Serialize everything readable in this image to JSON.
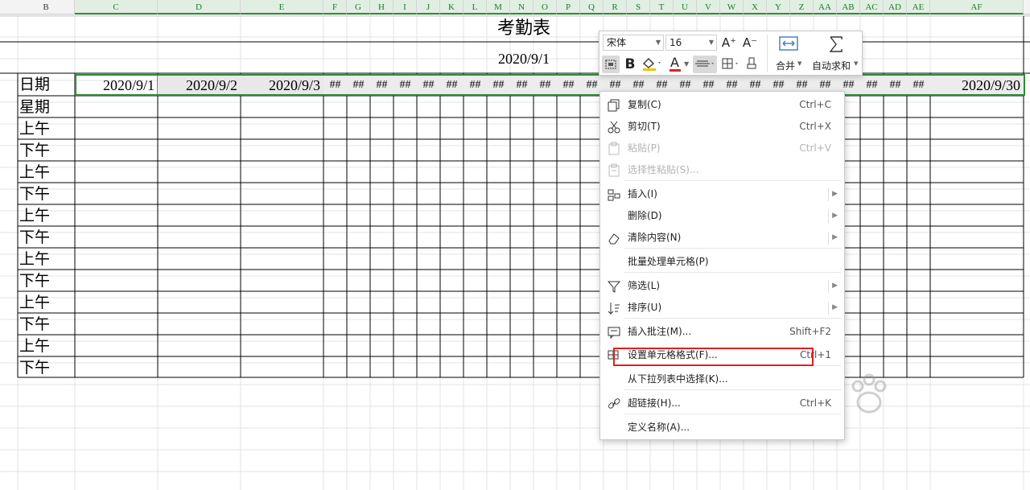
{
  "columns": [
    "B",
    "C",
    "D",
    "E",
    "F",
    "G",
    "H",
    "I",
    "J",
    "K",
    "L",
    "M",
    "N",
    "O",
    "P",
    "Q",
    "R",
    "S",
    "T",
    "U",
    "V",
    "W",
    "X",
    "Y",
    "Z",
    "AA",
    "AB",
    "AC",
    "AD",
    "AE",
    "AF"
  ],
  "title": "考勤表",
  "subtitle_date": "2020/9/1",
  "row_labels": [
    "日期",
    "星期",
    "上午",
    "下午",
    "上午",
    "下午",
    "上午",
    "下午",
    "上午",
    "下午",
    "上午",
    "下午",
    "上午",
    "下午"
  ],
  "dates": [
    "2020/9/1",
    "2020/9/2",
    "2020/9/3"
  ],
  "last_date": "2020/9/30",
  "overflow_marker": "##",
  "mini_toolbar": {
    "font_name": "宋体",
    "font_size": "16",
    "bold_label": "B",
    "font_color_label": "A",
    "grow_font": "A⁺",
    "shrink_font": "A⁻",
    "merge_label": "合并",
    "autosum_label": "自动求和"
  },
  "context_menu": [
    {
      "label": "复制(C)",
      "shortcut": "Ctrl+C",
      "icon": "copy-icon",
      "enabled": true
    },
    {
      "label": "剪切(T)",
      "shortcut": "Ctrl+X",
      "icon": "scissors-icon",
      "enabled": true
    },
    {
      "label": "粘贴(P)",
      "shortcut": "Ctrl+V",
      "icon": "paste-icon",
      "enabled": false
    },
    {
      "label": "选择性粘贴(S)...",
      "shortcut": "",
      "icon": "paste-special-icon",
      "enabled": false
    },
    {
      "label": "插入(I)",
      "shortcut": "",
      "icon": "insert-icon",
      "enabled": true,
      "submenu": true
    },
    {
      "label": "删除(D)",
      "shortcut": "",
      "icon": "",
      "enabled": true,
      "submenu": true
    },
    {
      "label": "清除内容(N)",
      "shortcut": "",
      "icon": "eraser-icon",
      "enabled": true,
      "submenu": true
    },
    {
      "label": "批量处理单元格(P)",
      "shortcut": "",
      "icon": "",
      "enabled": true
    },
    {
      "label": "筛选(L)",
      "shortcut": "",
      "icon": "filter-icon",
      "enabled": true,
      "submenu": true
    },
    {
      "label": "排序(U)",
      "shortcut": "",
      "icon": "sort-icon",
      "enabled": true,
      "submenu": true
    },
    {
      "label": "插入批注(M)...",
      "shortcut": "Shift+F2",
      "icon": "comment-icon",
      "enabled": true
    },
    {
      "label": "设置单元格格式(F)...",
      "shortcut": "Ctrl+1",
      "icon": "format-cells-icon",
      "enabled": true,
      "highlighted": true
    },
    {
      "label": "从下拉列表中选择(K)...",
      "shortcut": "",
      "icon": "",
      "enabled": true
    },
    {
      "label": "超链接(H)...",
      "shortcut": "Ctrl+K",
      "icon": "link-icon",
      "enabled": true
    },
    {
      "label": "定义名称(A)...",
      "shortcut": "",
      "icon": "",
      "enabled": true
    }
  ],
  "colors": {
    "selection": "#2e8b3a",
    "highlight": "#e02020",
    "font_color_bar": "#e02020",
    "fill_color_bar": "#f2c000"
  }
}
